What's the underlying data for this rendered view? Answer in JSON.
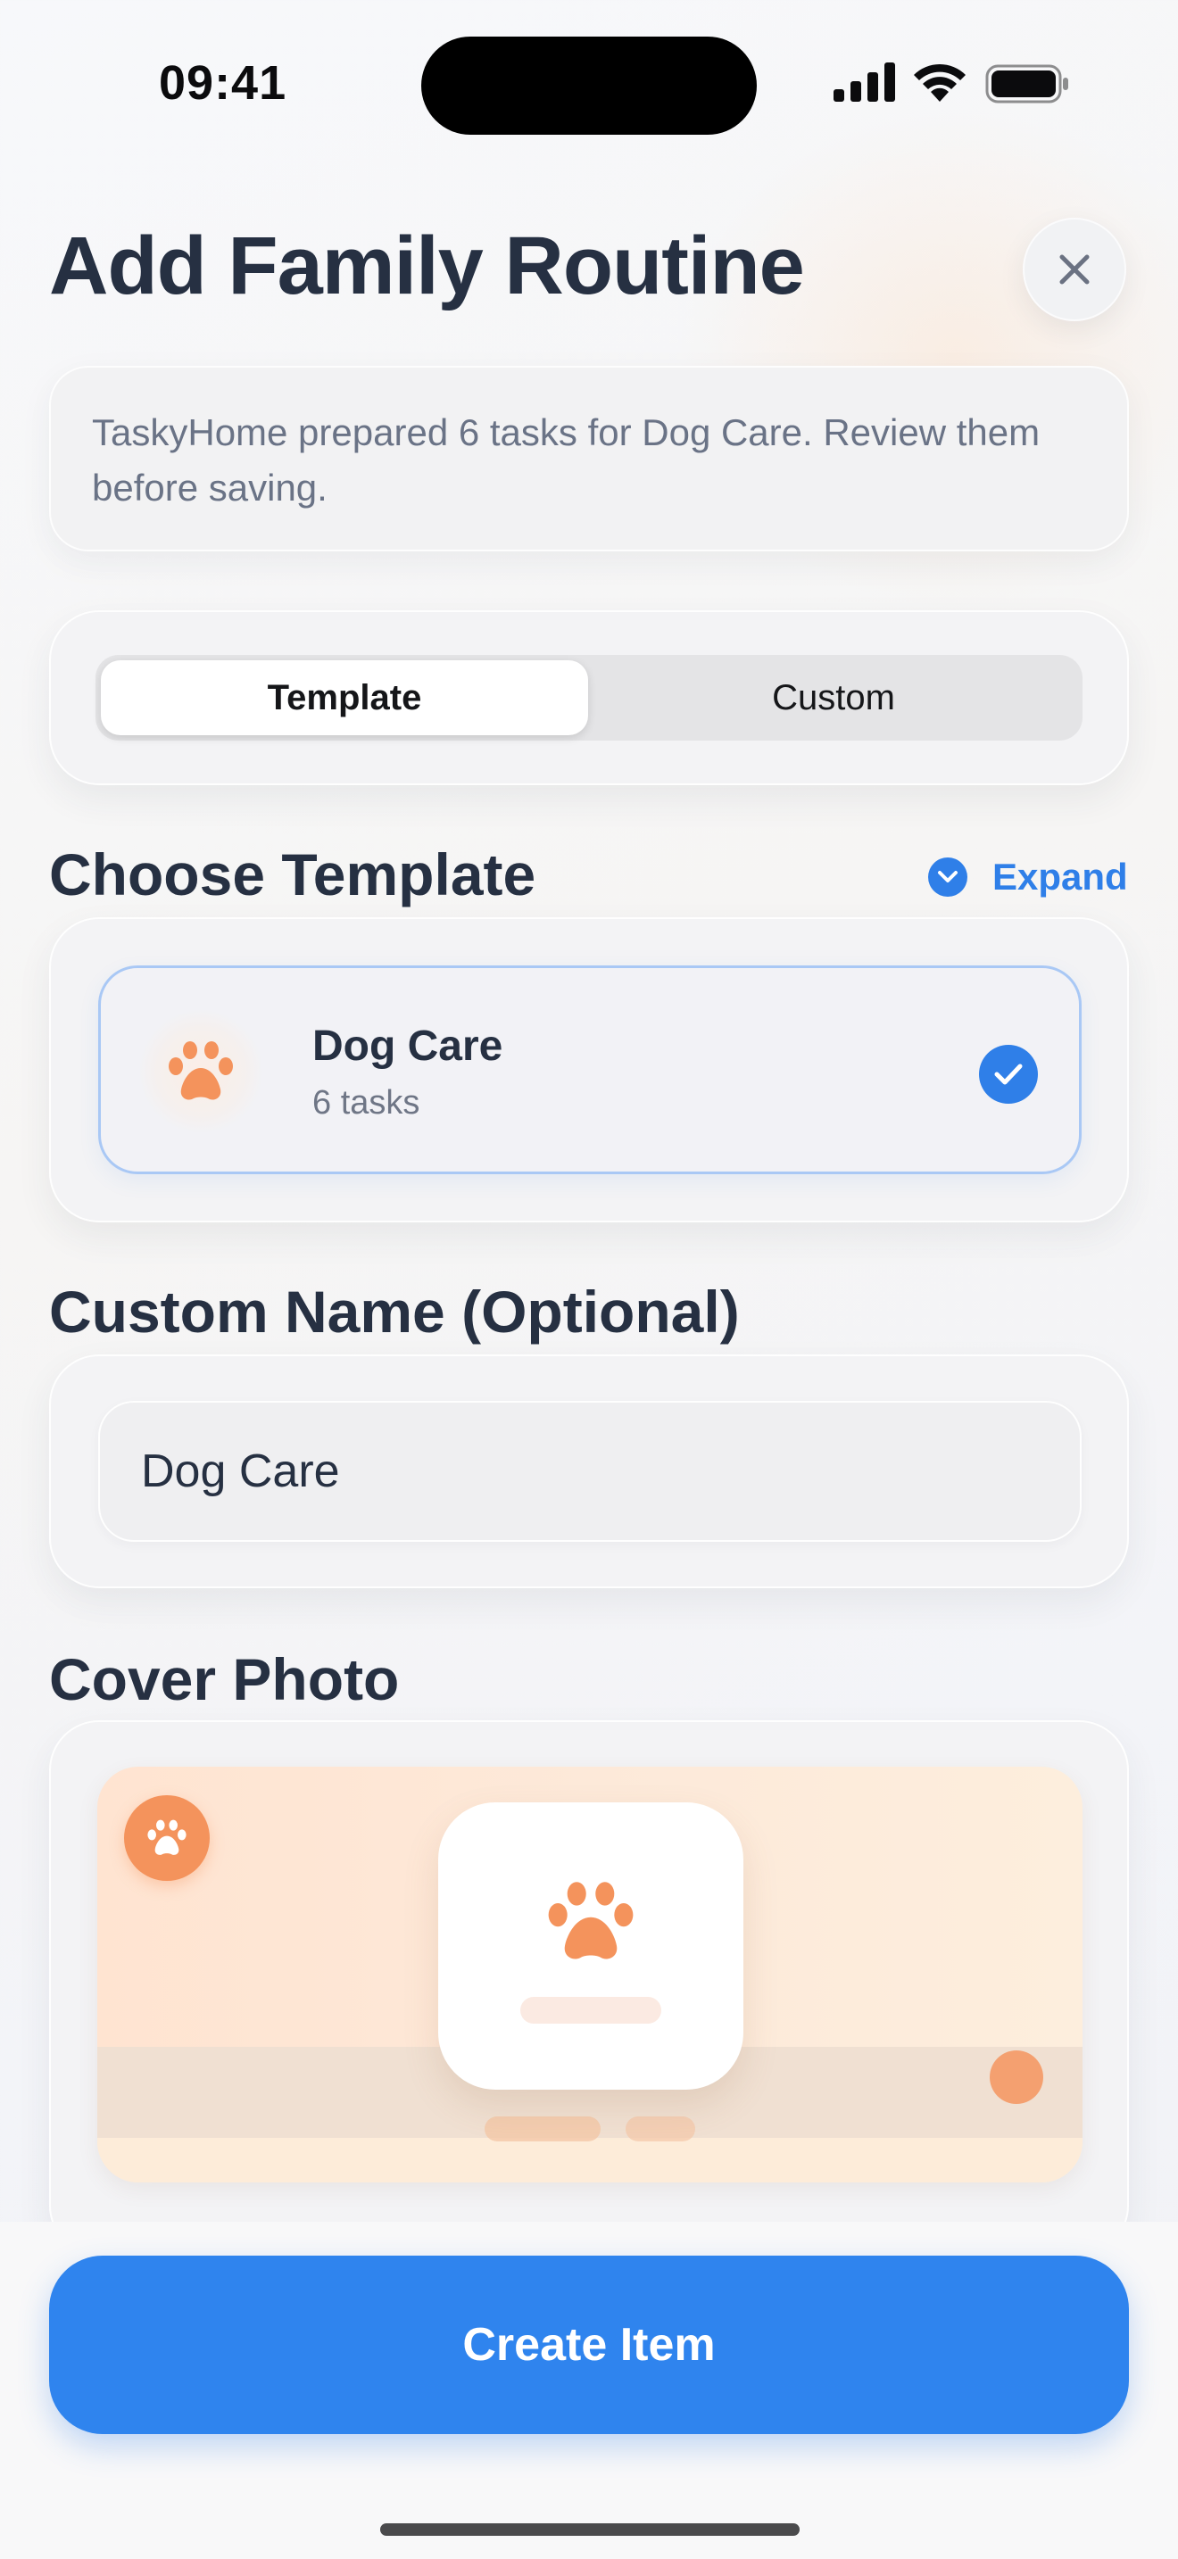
{
  "status_bar": {
    "time": "09:41"
  },
  "header": {
    "title": "Add Family Routine"
  },
  "info": {
    "text": "TaskyHome prepared 6 tasks for Dog Care. Review them before saving."
  },
  "mode": {
    "options": [
      "Template",
      "Custom"
    ],
    "selected": "Template"
  },
  "choose_template": {
    "title": "Choose Template",
    "expand_label": "Expand",
    "item": {
      "name": "Dog Care",
      "count": "6 tasks",
      "icon": "paw-icon",
      "selected": true
    }
  },
  "custom_name": {
    "title": "Custom Name (Optional)",
    "value": "Dog Care"
  },
  "cover_photo": {
    "title": "Cover Photo",
    "icon": "paw-icon"
  },
  "cta": {
    "label": "Create Item"
  },
  "colors": {
    "accent": "#2f84ee",
    "paw": "#f4935c",
    "text": "#263042",
    "muted": "#6a7386"
  }
}
